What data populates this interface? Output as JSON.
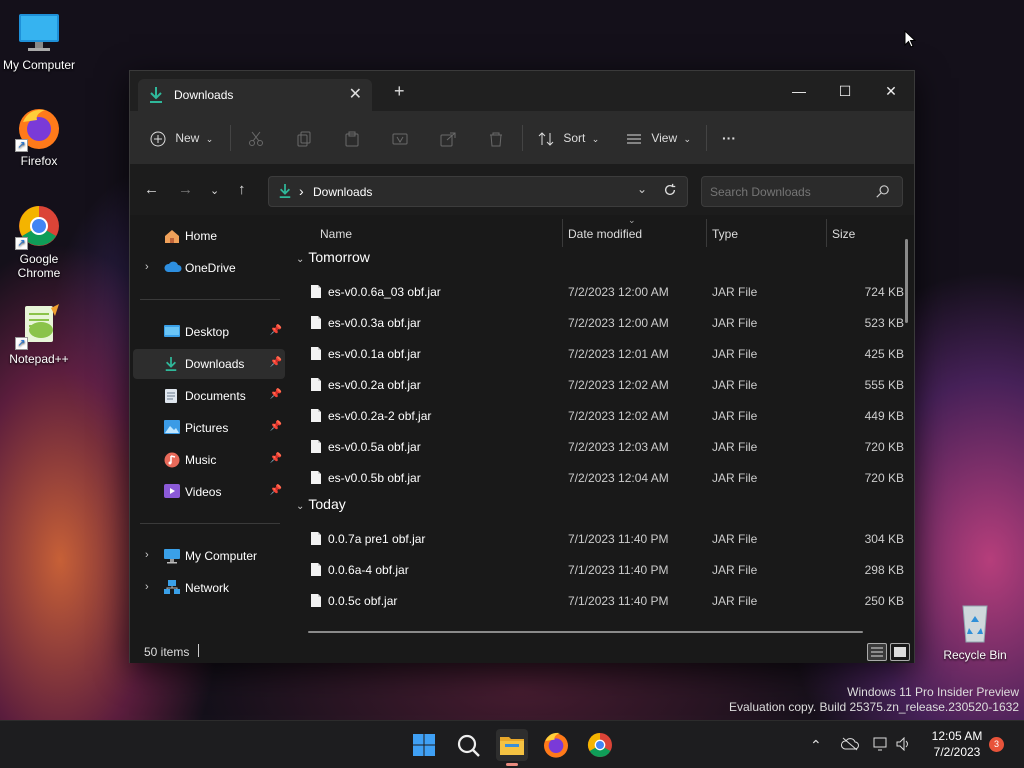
{
  "desktop": {
    "icons": [
      {
        "label": "My Computer"
      },
      {
        "label": "Firefox"
      },
      {
        "label": "Google Chrome"
      },
      {
        "label": "Notepad++"
      },
      {
        "label": "Recycle Bin"
      }
    ],
    "watermark": {
      "line1": "Windows 11 Pro Insider Preview",
      "line2": "Evaluation copy. Build 25375.zn_release.230520-1632"
    }
  },
  "window": {
    "tab_title": "Downloads",
    "new_tab": "+",
    "close_tab": "✕",
    "controls": {
      "minimize": "—",
      "maximize": "☐",
      "close": "✕"
    },
    "toolbar": {
      "new_label": "New",
      "sort_label": "Sort",
      "view_label": "View",
      "more_label": "···"
    },
    "address": {
      "path_sep": "›",
      "path": "Downloads"
    },
    "search": {
      "placeholder": "Search Downloads"
    },
    "sidebar": {
      "items": [
        {
          "label": "Home"
        },
        {
          "label": "OneDrive"
        },
        {
          "label": "Desktop"
        },
        {
          "label": "Downloads"
        },
        {
          "label": "Documents"
        },
        {
          "label": "Pictures"
        },
        {
          "label": "Music"
        },
        {
          "label": "Videos"
        },
        {
          "label": "My Computer"
        },
        {
          "label": "Network"
        }
      ]
    },
    "columns": {
      "name": "Name",
      "date": "Date modified",
      "type": "Type",
      "size": "Size"
    },
    "groups": [
      {
        "label": "Tomorrow",
        "files": [
          {
            "name": "es-v0.0.6a_03 obf.jar",
            "date": "7/2/2023 12:00 AM",
            "type": "JAR File",
            "size": "724 KB"
          },
          {
            "name": "es-v0.0.3a obf.jar",
            "date": "7/2/2023 12:00 AM",
            "type": "JAR File",
            "size": "523 KB"
          },
          {
            "name": "es-v0.0.1a obf.jar",
            "date": "7/2/2023 12:01 AM",
            "type": "JAR File",
            "size": "425 KB"
          },
          {
            "name": "es-v0.0.2a obf.jar",
            "date": "7/2/2023 12:02 AM",
            "type": "JAR File",
            "size": "555 KB"
          },
          {
            "name": "es-v0.0.2a-2 obf.jar",
            "date": "7/2/2023 12:02 AM",
            "type": "JAR File",
            "size": "449 KB"
          },
          {
            "name": "es-v0.0.5a obf.jar",
            "date": "7/2/2023 12:03 AM",
            "type": "JAR File",
            "size": "720 KB"
          },
          {
            "name": "es-v0.0.5b obf.jar",
            "date": "7/2/2023 12:04 AM",
            "type": "JAR File",
            "size": "720 KB"
          }
        ]
      },
      {
        "label": "Today",
        "files": [
          {
            "name": "0.0.7a pre1 obf.jar",
            "date": "7/1/2023 11:40 PM",
            "type": "JAR File",
            "size": "304 KB"
          },
          {
            "name": "0.0.6a-4 obf.jar",
            "date": "7/1/2023 11:40 PM",
            "type": "JAR File",
            "size": "298 KB"
          },
          {
            "name": "0.0.5c obf.jar",
            "date": "7/1/2023 11:40 PM",
            "type": "JAR File",
            "size": "250 KB"
          }
        ]
      }
    ],
    "status": {
      "count": "50 items"
    }
  },
  "taskbar": {
    "clock": {
      "time": "12:05 AM",
      "date": "7/2/2023"
    },
    "notification_count": "3",
    "icons": [
      "windows-start-icon",
      "search-icon",
      "file-explorer-icon",
      "firefox-icon",
      "chrome-icon"
    ]
  },
  "colors": {
    "accent": "#2fb89a",
    "folder_yellow": "#f5c242",
    "window_bg": "#191919",
    "toolbar_bg": "#2c2c2c"
  }
}
